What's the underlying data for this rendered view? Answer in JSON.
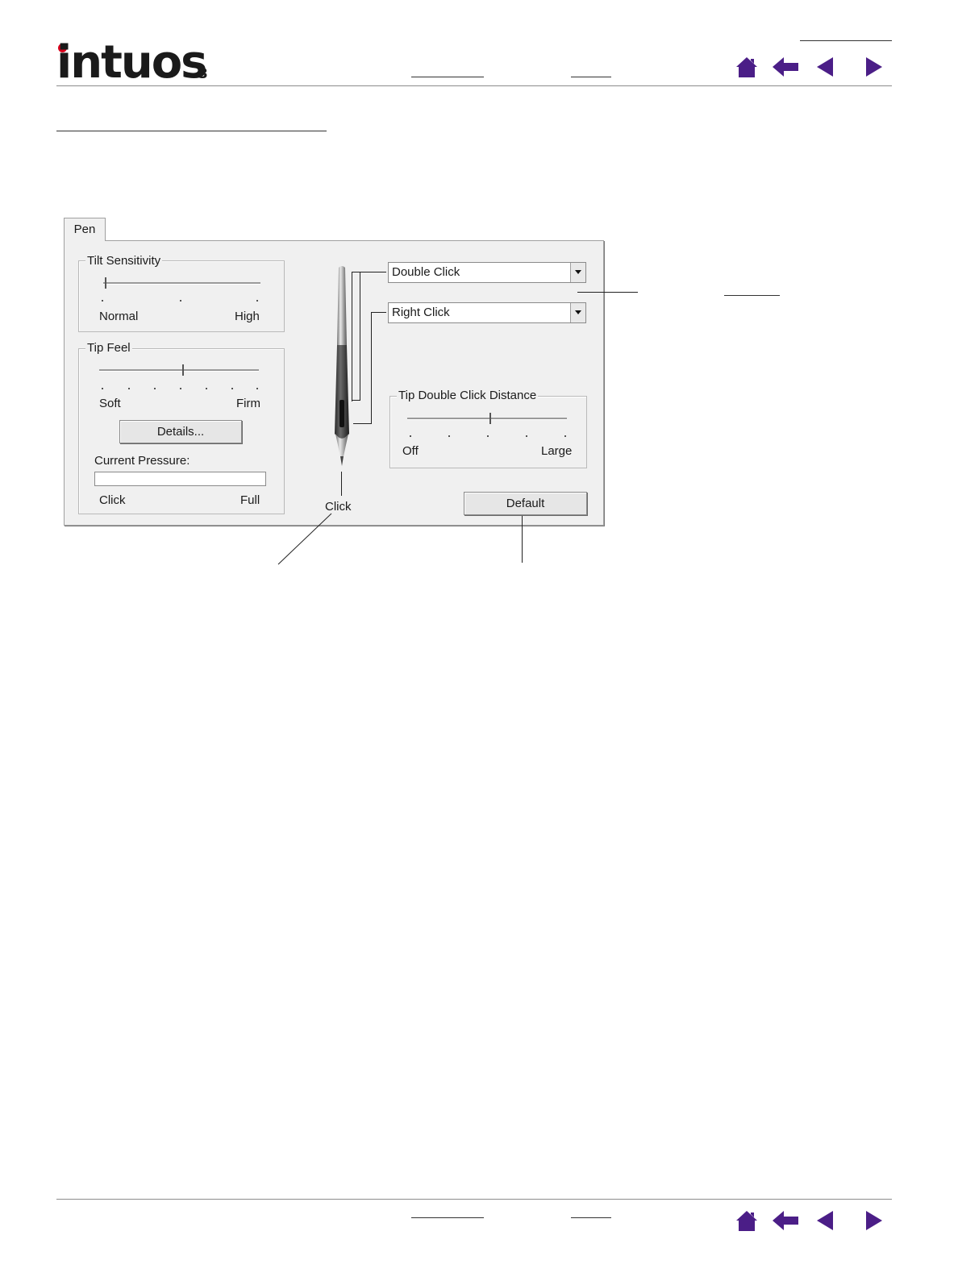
{
  "brand": {
    "name": "intuos",
    "version": "3",
    "dot_color": "#d9001b"
  },
  "nav": {
    "icon_color": "#4b1e87",
    "icons": [
      "home-icon",
      "back-arrow-icon",
      "previous-page-icon",
      "next-page-icon"
    ]
  },
  "dialog": {
    "tab_label": "Pen",
    "tilt_sensitivity": {
      "title": "Tilt Sensitivity",
      "min_label": "Normal",
      "max_label": "High",
      "level": 0.0
    },
    "tip_feel": {
      "title": "Tip Feel",
      "min_label": "Soft",
      "max_label": "Firm",
      "level": 0.5
    },
    "details_button": "Details...",
    "current_pressure": {
      "label": "Current Pressure:",
      "min_label": "Click",
      "max_label": "Full",
      "level": 0.0
    },
    "side_switch_upper": {
      "selected": "Double Click"
    },
    "side_switch_lower": {
      "selected": "Right Click"
    },
    "tip_label": "Click",
    "double_click_distance": {
      "title": "Tip Double Click Distance",
      "min_label": "Off",
      "max_label": "Large",
      "level": 0.5
    },
    "default_button": "Default"
  }
}
